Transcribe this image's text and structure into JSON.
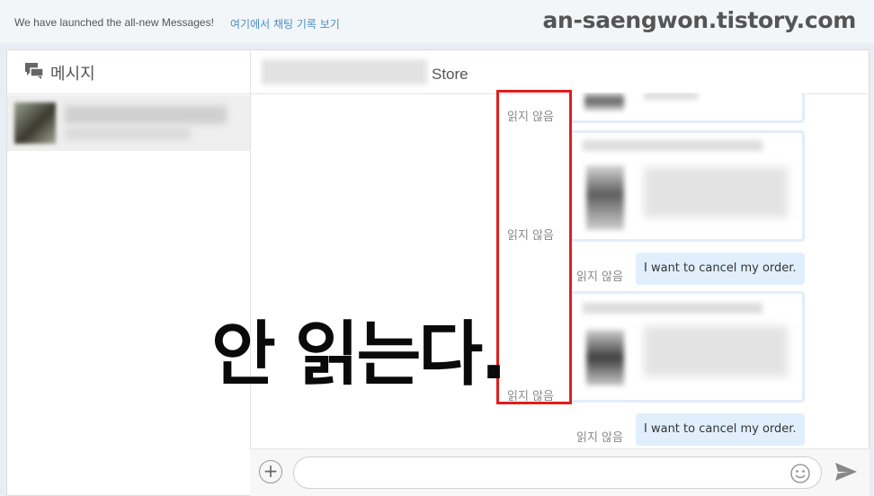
{
  "banner": {
    "text": "We have launched the all-new Messages!",
    "link": "여기에서 채팅 기록 보기"
  },
  "watermark": "an-saengwon.tistory.com",
  "sidebar": {
    "title": "메시지"
  },
  "chat": {
    "store_name": "Store",
    "unread_label": "읽지 않음",
    "messages": [
      {
        "text": "I want to cancel my order."
      },
      {
        "text": "I want to cancel my order."
      }
    ]
  },
  "overlay_text": "안 읽는다.",
  "colors": {
    "accent": "#4a8fc7",
    "bubble": "#e1effc",
    "card_border": "#e2eefa",
    "highlight": "#e21d1d"
  },
  "icons": [
    "message-icon",
    "plus-icon",
    "emoji-icon",
    "send-icon"
  ]
}
